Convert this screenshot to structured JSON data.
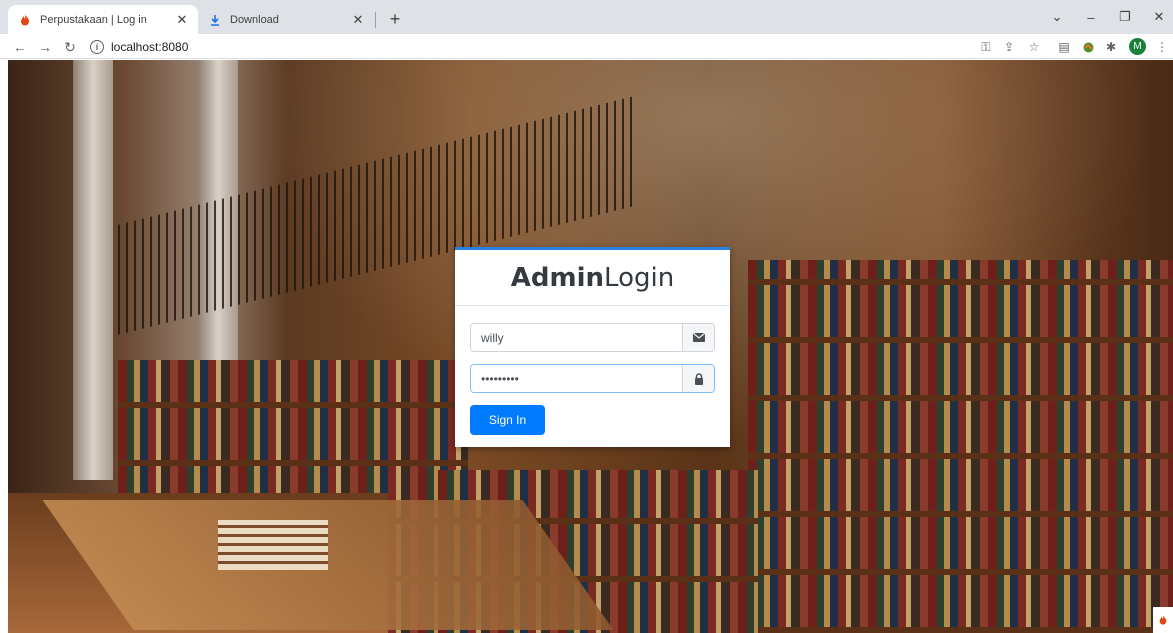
{
  "browser": {
    "tabs": [
      {
        "title": "Perpustakaan | Log in",
        "active": true
      },
      {
        "title": "Download",
        "active": false
      }
    ],
    "url": "localhost:8080",
    "profile_initial": "M",
    "icons": [
      "flame-icon",
      "download-icon",
      "back-icon",
      "forward-icon",
      "reload-icon",
      "info-icon",
      "key-icon",
      "share-icon",
      "star-icon",
      "reading-list-icon",
      "extension-icon",
      "puzzle-icon",
      "menu-icon"
    ]
  },
  "login": {
    "title_bold": "Admin",
    "title_normal": "Login",
    "username_value": "willy",
    "password_value": "•••••••••",
    "signin_label": "Sign In",
    "accent_color": "#2a82e6",
    "button_color": "#007bff"
  }
}
